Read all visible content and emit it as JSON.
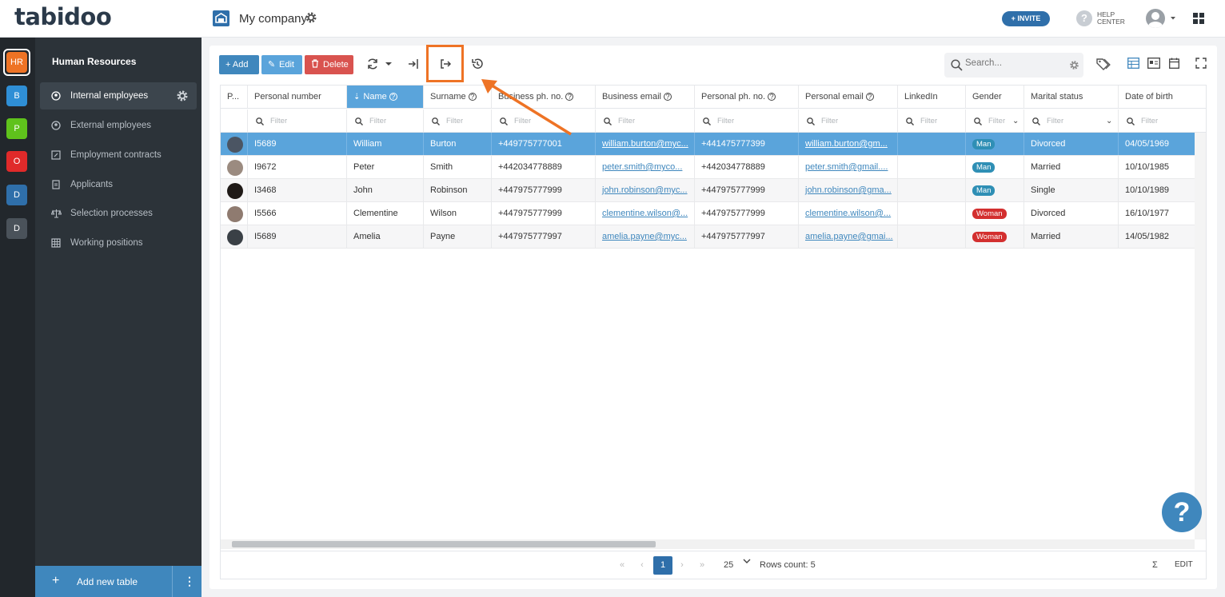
{
  "app": {
    "logo_text": "tabidoo",
    "company_name": "My company",
    "invite_label": "+ INVITE",
    "help_label_1": "HELP",
    "help_label_2": "CENTER",
    "help_glyph": "?"
  },
  "rail": {
    "items": [
      {
        "label": "HR",
        "color": "#ee7325"
      },
      {
        "label": "B",
        "color": "#2f8fd6"
      },
      {
        "label": "P",
        "color": "#5fc21c"
      },
      {
        "label": "O",
        "color": "#e02a2a"
      },
      {
        "label": "D",
        "color": "#2f6faa"
      },
      {
        "label": "D",
        "color": "#4a525a"
      }
    ]
  },
  "sidebar": {
    "title": "Human Resources",
    "items": [
      {
        "label": "Internal employees",
        "icon": "user-circle-icon",
        "active": true
      },
      {
        "label": "External employees",
        "icon": "user-circle-icon"
      },
      {
        "label": "Employment contracts",
        "icon": "edit-icon"
      },
      {
        "label": "Applicants",
        "icon": "document-icon"
      },
      {
        "label": "Selection processes",
        "icon": "scale-icon"
      },
      {
        "label": "Working positions",
        "icon": "grid-icon"
      }
    ],
    "add_table_label": "Add new table"
  },
  "toolbar": {
    "add_label": "+ Add",
    "edit_label": "Edit",
    "delete_label": "Delete",
    "search_placeholder": "Search..."
  },
  "table": {
    "columns": [
      "P...",
      "Personal number",
      "Name",
      "Surname",
      "Business ph. no.",
      "Business email",
      "Personal ph. no.",
      "Personal email",
      "LinkedIn",
      "Gender",
      "Marital status",
      "Date of birth"
    ],
    "filter_placeholder": "Filter",
    "rows": [
      {
        "personal_number": "I5689",
        "name": "William",
        "surname": "Burton",
        "business_phone": "+449775777001",
        "business_email": "william.burton@myc...",
        "personal_phone": "+441475777399",
        "personal_email": "william.burton@gm...",
        "linkedin": "",
        "gender": "Man",
        "marital_status": "Divorced",
        "date_of_birth": "04/05/1969"
      },
      {
        "personal_number": "I9672",
        "name": "Peter",
        "surname": "Smith",
        "business_phone": "+442034778889",
        "business_email": "peter.smith@myco...",
        "personal_phone": "+442034778889",
        "personal_email": "peter.smith@gmail....",
        "linkedin": "",
        "gender": "Man",
        "marital_status": "Married",
        "date_of_birth": "10/10/1985"
      },
      {
        "personal_number": "I3468",
        "name": "John",
        "surname": "Robinson",
        "business_phone": "+447975777999",
        "business_email": "john.robinson@myc...",
        "personal_phone": "+447975777999",
        "personal_email": "john.robinson@gma...",
        "linkedin": "",
        "gender": "Man",
        "marital_status": "Single",
        "date_of_birth": "10/10/1989"
      },
      {
        "personal_number": "I5566",
        "name": "Clementine",
        "surname": "Wilson",
        "business_phone": "+447975777999",
        "business_email": "clementine.wilson@...",
        "personal_phone": "+447975777999",
        "personal_email": "clementine.wilson@...",
        "linkedin": "",
        "gender": "Woman",
        "marital_status": "Divorced",
        "date_of_birth": "16/10/1977"
      },
      {
        "personal_number": "I5689",
        "name": "Amelia",
        "surname": "Payne",
        "business_phone": "+447975777997",
        "business_email": "amelia.payne@myc...",
        "personal_phone": "+447975777997",
        "personal_email": "amelia.payne@gmai...",
        "linkedin": "",
        "gender": "Woman",
        "marital_status": "Married",
        "date_of_birth": "14/05/1982"
      }
    ]
  },
  "pager": {
    "current_page": "1",
    "page_size": "25",
    "rows_count": "Rows count: 5",
    "sigma": "Σ",
    "edit_label": "EDIT",
    "first": "«",
    "prev": "‹",
    "next": "›",
    "last": "»"
  },
  "colors": {
    "accent": "#3f87bd",
    "selected_row": "#5aa4db",
    "delete": "#d9534f",
    "highlight": "#ee7325"
  }
}
